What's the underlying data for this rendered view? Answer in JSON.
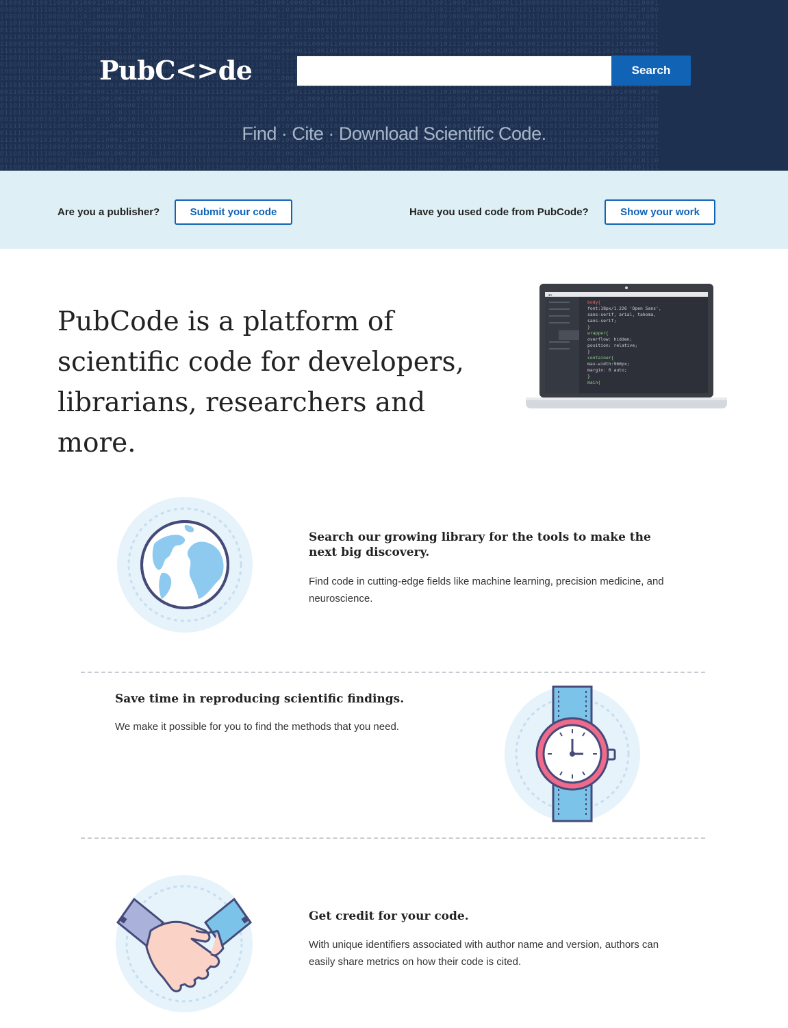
{
  "header": {
    "logo": "PubC<>de",
    "search_placeholder": "",
    "search_value": "",
    "search_button": "Search",
    "tagline": "Find · Cite · Download Scientific Code."
  },
  "cta": {
    "publisher_question": "Are you a publisher?",
    "publisher_button": "Submit your code",
    "user_question": "Have you used code from PubCode?",
    "user_button": "Show your work"
  },
  "intro": {
    "line1": "PubCode is a platform of",
    "line2": "scientific code for developers,",
    "line3": "librarians, researchers and more."
  },
  "laptop_code": [
    "body{",
    "  font:18px/1.226 'Open Sans',",
    "  sans-serif, arial, tahoma,",
    "  sans-serif;",
    "}",
    "wrapper{",
    "  overflow: hidden;",
    "  position: relative;",
    "}",
    "container{",
    "  max-width:960px;",
    "  margin: 0 auto;",
    "}",
    "main{"
  ],
  "features": [
    {
      "title": "Search our growing library for the tools to make the next big discovery.",
      "text": "Find code in cutting-edge fields like machine learning, precision medicine, and neuroscience.",
      "icon": "globe-icon"
    },
    {
      "title": "Save time in reproducing scientific findings.",
      "text": "We make it possible for you to find the methods that you need.",
      "icon": "watch-icon"
    },
    {
      "title": "Get credit for your code.",
      "text": "With unique identifiers associated with author name and version, authors can easily share metrics on how their code is cited.",
      "icon": "handshake-icon"
    }
  ],
  "colors": {
    "header_bg": "#1e3050",
    "accent": "#1063b5",
    "band_bg": "#def0f5"
  }
}
